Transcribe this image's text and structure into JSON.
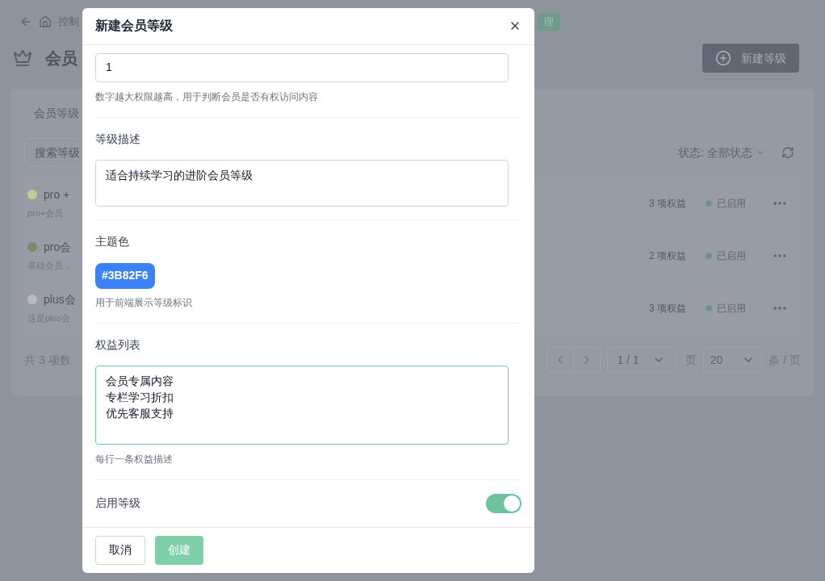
{
  "page": {
    "breadcrumb": "控制",
    "tag": "理",
    "title": "会员",
    "new_button": "新建等级",
    "tab": "会员等级",
    "search": {
      "placeholder": "搜索等级"
    },
    "status_filter": {
      "label": "状态:",
      "value": "全部状态"
    },
    "rows": [
      {
        "name": "pro +",
        "desc": "pro+会员",
        "color": "#c8cb90",
        "benefits": "3 项权益",
        "status": "已启用"
      },
      {
        "name": "pro会",
        "desc": "基础会员，",
        "color": "#7b8a6c",
        "benefits": "2 项权益",
        "status": "已启用"
      },
      {
        "name": "plus会",
        "desc": "这是plus会",
        "color": "#b8bcc2",
        "benefits": "3 项权益",
        "status": "已启用"
      }
    ],
    "footer": {
      "total": "共 3 项数",
      "page": "1 / 1",
      "page_unit": "页",
      "page_size": "20",
      "size_unit": "条 / 页"
    }
  },
  "dialog": {
    "title": "新建会员等级",
    "level_field": {
      "value": "1",
      "hint": "数字越大权限越高，用于判断会员是否有权访问内容"
    },
    "description": {
      "label": "等级描述",
      "value": "适合持续学习的进阶会员等级"
    },
    "theme_color": {
      "label": "主题色",
      "value": "#3B82F6",
      "color": "#3b82f6",
      "hint": "用于前端展示等级标识"
    },
    "benefits": {
      "label": "权益列表",
      "lines": [
        "会员专属内容",
        "专栏学习折扣",
        "优先客服支持"
      ],
      "hint": "每行一条权益描述"
    },
    "enabled": {
      "label": "启用等级",
      "on": true
    },
    "buttons": {
      "cancel": "取消",
      "create": "创建"
    }
  }
}
